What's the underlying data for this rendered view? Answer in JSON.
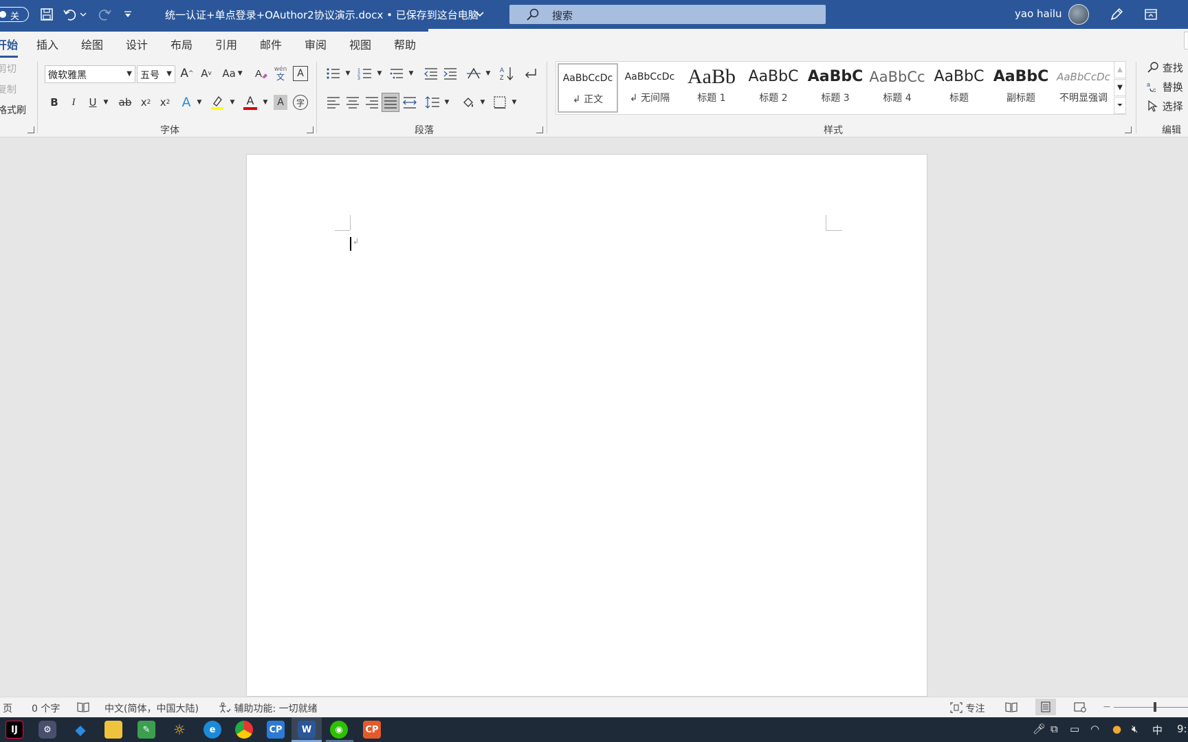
{
  "app": {
    "autosave_label": "关",
    "doc_title": "统一认证+单点登录+OAuthor2协议演示.docx • 已保存到这台电脑",
    "search_label": "搜索",
    "username": "yao hailu"
  },
  "tabs": [
    "开始",
    "插入",
    "绘图",
    "设计",
    "布局",
    "引用",
    "邮件",
    "审阅",
    "视图",
    "帮助"
  ],
  "clipboard": {
    "cut": "剪切",
    "copy": "复制",
    "format_painter": "格式刷"
  },
  "font": {
    "group_label": "字体",
    "font_name": "微软雅黑",
    "font_size": "五号",
    "grow_label": "A",
    "shrink_label": "A",
    "case_label": "Aa",
    "phonetic_label": "wén",
    "phonetic_sub": "文",
    "border_label": "A",
    "bold": "B",
    "italic": "I",
    "underline": "U",
    "strike": "ab",
    "subscript": "x",
    "superscript": "x",
    "effect_label": "A",
    "font_color_label": "A",
    "shading_label": "A",
    "enclose_label": "字",
    "highlight_color": "#ffff00",
    "font_color": "#e00000"
  },
  "paragraph": {
    "group_label": "段落"
  },
  "styles": {
    "group_label": "样式",
    "items": [
      {
        "preview": "AaBbCcDc",
        "name": "正文",
        "selected": true
      },
      {
        "preview": "AaBbCcDc",
        "name": "无间隔",
        "selected": false
      },
      {
        "preview": "AaBb",
        "name": "标题 1",
        "selected": false
      },
      {
        "preview": "AaBbC",
        "name": "标题 2",
        "selected": false
      },
      {
        "preview": "AaBbC",
        "name": "标题 3",
        "selected": false
      },
      {
        "preview": "AaBbCc",
        "name": "标题 4",
        "selected": false
      },
      {
        "preview": "AaBbC",
        "name": "标题",
        "selected": false
      },
      {
        "preview": "AaBbC",
        "name": "副标题",
        "selected": false
      },
      {
        "preview": "AaBbCcDc",
        "name": "不明显强调",
        "selected": false
      }
    ]
  },
  "editing": {
    "group_label": "编辑",
    "find": "查找",
    "replace": "替换",
    "select": "选择"
  },
  "status": {
    "page": "页",
    "words": "0 个字",
    "language": "中文(简体，中国大陆)",
    "accessibility": "辅助功能: 一切就绪",
    "focus": "专注"
  },
  "taskbar": {
    "ime": "中",
    "clock": "9:"
  },
  "colors": {
    "brand": "#2b579a",
    "ribbon_bg": "#f3f3f3",
    "taskbar_bg": "#1f2a38"
  }
}
